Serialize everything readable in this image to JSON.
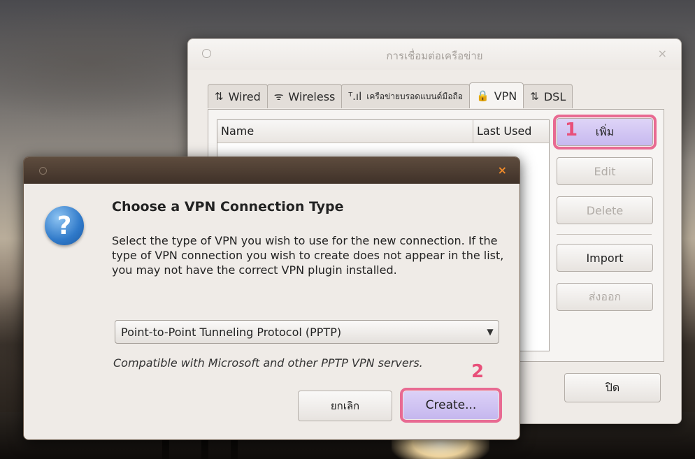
{
  "network_window": {
    "title": "การเชื่อมต่อเครือข่าย",
    "close_glyph": "×",
    "tabs": [
      {
        "icon": "⇅",
        "label": "Wired"
      },
      {
        "icon": "ᯤ",
        "label": "Wireless"
      },
      {
        "icon": "ᵀ.ıl",
        "label": "เครือข่ายบรอดแบนด์มือถือ"
      },
      {
        "icon": "🔒",
        "label": "VPN"
      },
      {
        "icon": "⇅",
        "label": "DSL"
      }
    ],
    "active_tab": "VPN",
    "list_headers": {
      "name": "Name",
      "last_used": "Last Used"
    },
    "buttons": {
      "add": "เพิ่ม",
      "edit": "Edit",
      "delete": "Delete",
      "import": "Import",
      "export": "ส่งออก",
      "close": "ปิด"
    },
    "markers": {
      "step1": "1"
    }
  },
  "vpn_dialog": {
    "close_glyph": "×",
    "icon": "?",
    "heading": "Choose a VPN Connection Type",
    "description": "Select the type of VPN you wish to use for the new connection.  If the type of VPN connection you wish to create does not appear in the list, you may not have the correct VPN plugin installed.",
    "selected_type": "Point-to-Point Tunneling Protocol (PPTP)",
    "select_arrow": "▼",
    "compat_note": "Compatible with Microsoft and other PPTP VPN servers.",
    "buttons": {
      "cancel": "ยกเลิก",
      "create": "Create..."
    },
    "markers": {
      "step2": "2"
    }
  },
  "colors": {
    "highlight": "#e86a92",
    "primary_button": "#c7b9ef",
    "dialog_titlebar": "#4a3a2e"
  }
}
